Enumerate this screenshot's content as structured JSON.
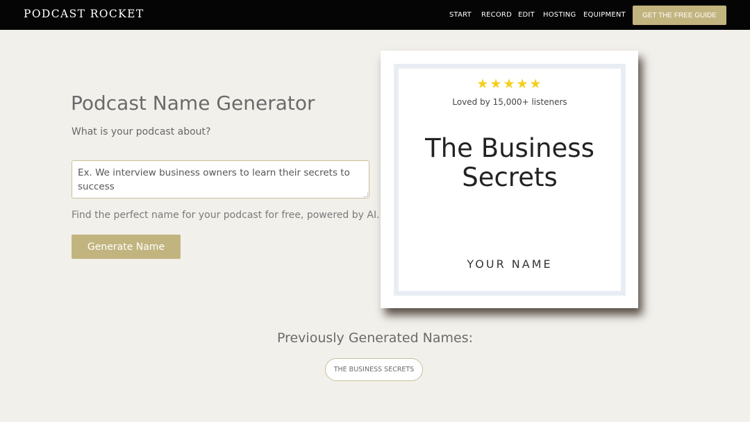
{
  "header": {
    "logo": "PODCAST ROCKET",
    "nav": [
      {
        "label": "START"
      },
      {
        "label": "RECORD"
      },
      {
        "label": "EDIT"
      },
      {
        "label": "HOSTING"
      },
      {
        "label": "EQUIPMENT"
      }
    ],
    "cta_label": "GET THE FREE GUIDE"
  },
  "generator": {
    "title": "Podcast Name Generator",
    "prompt": "What is your podcast about?",
    "input": {
      "value": "",
      "placeholder": "Ex. We interview business owners to learn their secrets to success"
    },
    "helper": "Find the perfect name for your podcast for free, powered by AI.",
    "button_label": "Generate Name"
  },
  "preview": {
    "stars": "★★★★★",
    "rating_count_text": "Loved by 15,000+ listeners",
    "podcast_name": "The Business Secrets",
    "author": "YOUR NAME"
  },
  "history": {
    "title": "Previously Generated Names:",
    "items": [
      {
        "label": "THE BUSINESS SECRETS"
      }
    ]
  },
  "colors": {
    "header_bg": "#050505",
    "accent": "#c2b47f",
    "page_bg": "#f2f0eb",
    "stars": "#f5cf1c"
  }
}
